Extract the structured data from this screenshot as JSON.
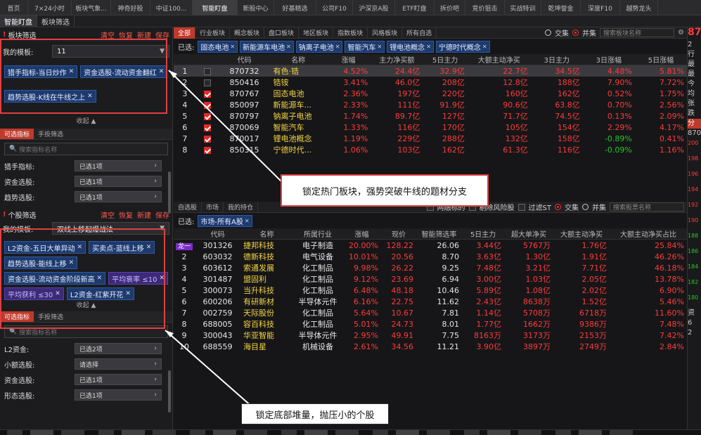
{
  "top_tabs": [
    "首页",
    "7×24小时",
    "板块气象...",
    "神奇好股",
    "中证100...",
    "智能盯盘",
    "新股中心",
    "好基精选",
    "公司F10",
    "沪深京A股",
    "ETF盯盘",
    "拆价吧",
    "竞价狙击",
    "实战特训",
    "乾坤誉金",
    "深度F10",
    "越势龙头"
  ],
  "top_tabs_active": 5,
  "sub_tabs": [
    "智能盯盘",
    "板块筛选"
  ],
  "sector_filter": {
    "title": "板块筛选",
    "actions": [
      "清空",
      "恢复",
      "新建",
      "保存"
    ],
    "template_label": "我的模板:",
    "template_value": "11",
    "chips": [
      "猎手指标-当日炒作",
      "资金选股-流动资金翻红",
      "趋势选股-K线在牛线之上"
    ],
    "collapse": "收起",
    "filter_tabs": [
      "可选指标",
      "手投筛选"
    ],
    "search_placeholder": "搜索指标名称",
    "filters": [
      {
        "label": "猎手指标:",
        "value": "已选1项"
      },
      {
        "label": "资金选股:",
        "value": "已选1项"
      },
      {
        "label": "趋势选股:",
        "value": "已选1项"
      }
    ]
  },
  "stock_filter": {
    "title": "个股筛选",
    "actions": [
      "清空",
      "恢复",
      "新建",
      "保存"
    ],
    "template_label": "我的模板:",
    "template_value": "双线上移起爆战法",
    "chips": [
      {
        "text": "L2资金-五日大单异动",
        "purple": false
      },
      {
        "text": "买卖点-蓝线上移",
        "purple": false
      },
      {
        "text": "趋势选股-能线上移",
        "purple": false
      },
      {
        "text": "资金选股-流动资金阶段新高",
        "purple": false
      },
      {
        "text": "平均衰率 ≤10",
        "purple": true
      },
      {
        "text": "平均获利 ≤30",
        "purple": true
      },
      {
        "text": "L2资金-红紫开花",
        "purple": false
      }
    ],
    "collapse": "收起",
    "filter_tabs": [
      "可选指标",
      "手投筛选"
    ],
    "search_placeholder": "搜索指标名称",
    "filters": [
      {
        "label": "L2资金:",
        "value": "已选2项"
      },
      {
        "label": "小额选股:",
        "value": "请选择"
      },
      {
        "label": "资金选股:",
        "value": "已选1项"
      },
      {
        "label": "形态选股:",
        "value": "已选1项"
      }
    ]
  },
  "sector_table": {
    "tabs": [
      "全部",
      "行业板块",
      "概念板块",
      "盘口板块",
      "地区板块",
      "指数板块",
      "风格板块",
      "所有自选"
    ],
    "mode": {
      "intersect": "交集",
      "union": "并集"
    },
    "search_placeholder": "搜索板块名称",
    "selected_label": "已选:",
    "selected_chips": [
      "固态电池",
      "新能源车电池",
      "钠离子电池",
      "智能汽车",
      "锂电池概念",
      "宁德时代概念"
    ],
    "headers": [
      "",
      "",
      "代码",
      "名称",
      "涨幅",
      "主力净买额",
      "5日主力",
      "大额主动净买",
      "3日主力",
      "3日涨幅",
      "5日涨幅"
    ],
    "rows": [
      {
        "idx": "1",
        "checked": false,
        "code": "870732",
        "name": "有色·锆",
        "chg": "4.52%",
        "main": "24.4亿",
        "main5": "32.9亿",
        "big": "22.7亿",
        "main3": "34.5亿",
        "chg3": "4.48%",
        "chg5": "5.81%",
        "hl": true
      },
      {
        "idx": "2",
        "checked": false,
        "code": "850416",
        "name": "锆铵",
        "chg": "3.41%",
        "main": "46.0亿",
        "main5": "208亿",
        "big": "12.8亿",
        "main3": "188亿",
        "chg3": "7.90%",
        "chg5": "7.72%"
      },
      {
        "idx": "3",
        "checked": true,
        "code": "870767",
        "name": "固态电池",
        "chg": "2.36%",
        "main": "197亿",
        "main5": "220亿",
        "big": "160亿",
        "main3": "162亿",
        "chg3": "0.52%",
        "chg5": "1.75%"
      },
      {
        "idx": "4",
        "checked": true,
        "code": "850097",
        "name": "新能源车...",
        "chg": "2.33%",
        "main": "111亿",
        "main5": "91.9亿",
        "big": "90.6亿",
        "main3": "63.8亿",
        "chg3": "0.70%",
        "chg5": "2.56%"
      },
      {
        "idx": "5",
        "checked": true,
        "code": "870797",
        "name": "钠离子电池",
        "chg": "1.74%",
        "main": "89.7亿",
        "main5": "127亿",
        "big": "71.7亿",
        "main3": "74.5亿",
        "chg3": "0.13%",
        "chg5": "2.09%"
      },
      {
        "idx": "6",
        "checked": true,
        "code": "870069",
        "name": "智能汽车",
        "chg": "1.33%",
        "main": "116亿",
        "main5": "170亿",
        "big": "105亿",
        "main3": "154亿",
        "chg3": "2.29%",
        "chg5": "4.17%"
      },
      {
        "idx": "7",
        "checked": true,
        "code": "870017",
        "name": "锂电池概念",
        "chg": "1.19%",
        "main": "229亿",
        "main5": "288亿",
        "big": "132亿",
        "main3": "158亿",
        "chg3": "-0.89%",
        "chg5": "0.41%"
      },
      {
        "idx": "8",
        "checked": true,
        "code": "850315",
        "name": "宁德时代...",
        "chg": "1.06%",
        "main": "103亿",
        "main5": "162亿",
        "big": "61.3亿",
        "main3": "116亿",
        "chg3": "-0.09%",
        "chg5": "1.16%"
      }
    ]
  },
  "callout1": "锁定热门板块，强势突破牛线的题材分支",
  "stock_table": {
    "tabs": [
      "自选股",
      "市场",
      "我的持仓"
    ],
    "options": [
      "两融标的",
      "剔除风险股",
      "过滤ST"
    ],
    "mode": {
      "intersect": "交集",
      "union": "并集"
    },
    "search_placeholder": "搜索股票名称",
    "selected_label": "已选:",
    "selected_chips": [
      "市场-所有A股"
    ],
    "headers": [
      "",
      "代码",
      "名称",
      "所属行业",
      "涨幅",
      "现价",
      "智能筛选率",
      "5日主力",
      "超大单净买",
      "大额主动净买",
      "大额主动净买占比"
    ],
    "rows": [
      {
        "idx": "龙一",
        "code": "301326",
        "name": "捷邦科技",
        "ind": "电子制造",
        "chg": "20.00%",
        "price": "128.22",
        "rate": "26.06",
        "m5": "3.44亿",
        "xl": "5767万",
        "big": "1.76亿",
        "pct": "25.84%"
      },
      {
        "idx": "2",
        "code": "603032",
        "name": "德新科技",
        "ind": "电气设备",
        "chg": "10.01%",
        "price": "20.56",
        "rate": "8.70",
        "m5": "3.63亿",
        "xl": "1.30亿",
        "big": "1.91亿",
        "pct": "46.26%"
      },
      {
        "idx": "3",
        "code": "603612",
        "name": "索通发展",
        "ind": "化工制品",
        "chg": "9.98%",
        "price": "26.22",
        "rate": "9.25",
        "m5": "7.48亿",
        "xl": "3.21亿",
        "big": "7.71亿",
        "pct": "46.18%"
      },
      {
        "idx": "4",
        "code": "301487",
        "name": "盟固利",
        "ind": "化工制品",
        "chg": "9.12%",
        "price": "23.69",
        "rate": "6.94",
        "m5": "3.00亿",
        "xl": "1.03亿",
        "big": "2.05亿",
        "pct": "13.78%"
      },
      {
        "idx": "5",
        "code": "300073",
        "name": "当升科技",
        "ind": "化工制品",
        "chg": "6.48%",
        "price": "48.18",
        "rate": "10.46",
        "m5": "5.89亿",
        "xl": "1.08亿",
        "big": "2.02亿",
        "pct": "6.90%"
      },
      {
        "idx": "6",
        "code": "600206",
        "name": "有研新材",
        "ind": "半导体元件",
        "chg": "6.16%",
        "price": "22.75",
        "rate": "11.62",
        "m5": "2.43亿",
        "xl": "8638万",
        "big": "1.52亿",
        "pct": "5.46%"
      },
      {
        "idx": "7",
        "code": "002759",
        "name": "天际股份",
        "ind": "化工制品",
        "chg": "5.64%",
        "price": "10.67",
        "rate": "7.81",
        "m5": "1.14亿",
        "xl": "5708万",
        "big": "6718万",
        "pct": "11.60%"
      },
      {
        "idx": "8",
        "code": "688005",
        "name": "容百科技",
        "ind": "化工制品",
        "chg": "5.01%",
        "price": "24.73",
        "rate": "8.01",
        "m5": "1.77亿",
        "xl": "1662万",
        "big": "9386万",
        "pct": "7.48%"
      },
      {
        "idx": "9",
        "code": "300043",
        "name": "华亚智能",
        "ind": "半导体元件",
        "chg": "2.95%",
        "price": "49.91",
        "rate": "7.75",
        "m5": "8163万",
        "xl": "3173万",
        "big": "2153万",
        "pct": "7.42%"
      },
      {
        "idx": "10",
        "code": "688559",
        "name": "海目星",
        "ind": "机械设备",
        "chg": "2.61%",
        "price": "34.56",
        "rate": "11.21",
        "m5": "3.90亿",
        "xl": "3897万",
        "big": "2749万",
        "pct": "2.84%"
      }
    ]
  },
  "callout2": "锁定底部堆量，抛压小的个股",
  "right_panel": {
    "values": [
      "87",
      "2",
      "行",
      "最",
      "最",
      "今",
      "均",
      "张",
      "跌",
      "分",
      "870",
      "200",
      "198",
      "196",
      "194",
      "192",
      "190",
      "188",
      "186",
      "184",
      "182",
      "180",
      "资",
      "6",
      "2"
    ]
  }
}
